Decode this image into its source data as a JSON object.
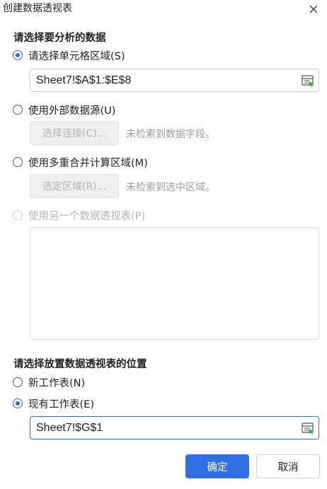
{
  "dialog": {
    "title": "创建数据透视表"
  },
  "source": {
    "heading": "请选择要分析的数据",
    "option_range_label": "请选择单元格区域(S)",
    "range_value": "Sheet7!$A$1:$E$8",
    "option_external_label": "使用外部数据源(U)",
    "choose_connection_label": "选择连接(C)...",
    "external_hint": "未检索到数据字段。",
    "option_multi_label": "使用多重合并计算区域(M)",
    "select_region_label": "选定区域(R)...",
    "multi_hint": "未检索到选中区域。",
    "option_other_pivot_label": "使用另一个数据透视表(P)"
  },
  "placement": {
    "heading": "请选择放置数据透视表的位置",
    "option_new_sheet_label": "新工作表(N)",
    "option_existing_sheet_label": "现有工作表(E)",
    "location_value": "Sheet7!$G$1"
  },
  "buttons": {
    "ok_label": "确定",
    "cancel_label": "取消"
  },
  "colors": {
    "accent": "#2b6ce0",
    "primary_button": "#2f6fe3"
  },
  "icons": {
    "close": "close-icon",
    "range_picker": "range-picker-icon"
  }
}
